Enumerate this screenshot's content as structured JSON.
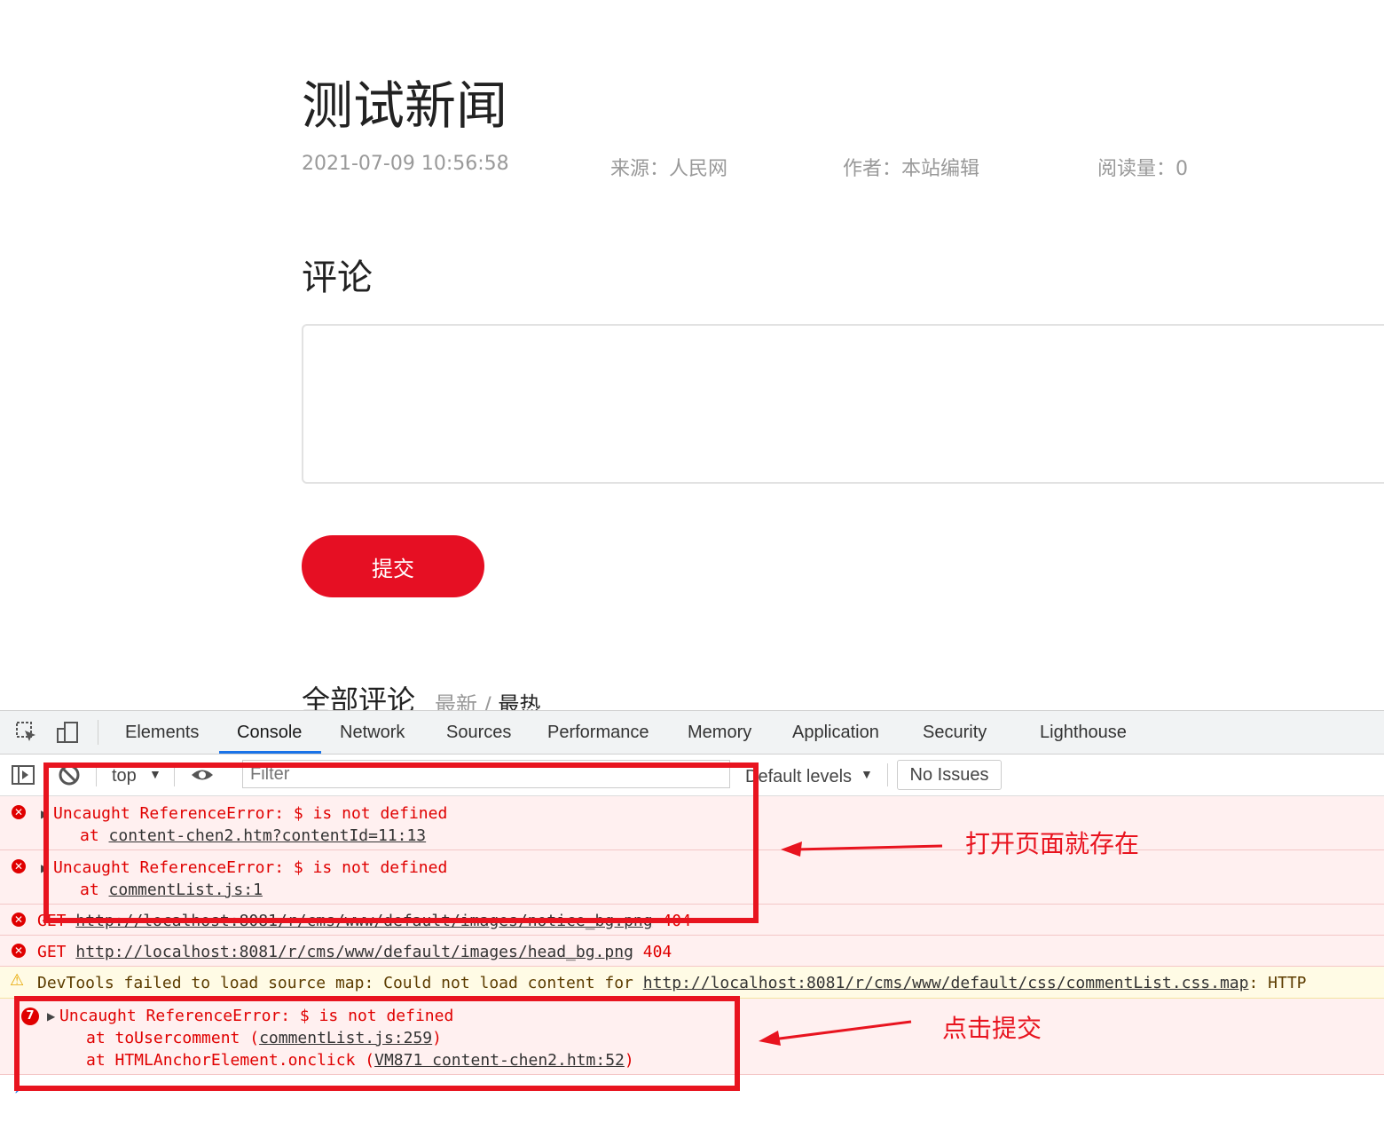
{
  "article": {
    "title": "测试新闻",
    "date": "2021-07-09 10:56:58",
    "source": "来源：人民网",
    "author": "作者：本站编辑",
    "reads": "阅读量：0"
  },
  "comment": {
    "heading": "评论",
    "submit_label": "提交",
    "all_label": "全部评论",
    "sort_latest": "最新",
    "sort_sep": " / ",
    "sort_hot": "最热"
  },
  "devtools": {
    "tabs": [
      "Elements",
      "Console",
      "Network",
      "Sources",
      "Performance",
      "Memory",
      "Application",
      "Security",
      "Lighthouse"
    ],
    "active_tab": "Console",
    "context": "top",
    "filter_placeholder": "Filter",
    "levels": "Default levels",
    "issues": "No Issues",
    "messages": [
      {
        "type": "error",
        "text": "Uncaught ReferenceError: $ is not defined",
        "at_prefix": "at ",
        "link": "content-chen2.htm?contentId=11:13"
      },
      {
        "type": "error",
        "text": "Uncaught ReferenceError: $ is not defined",
        "at_prefix": "at ",
        "link": "commentList.js:1"
      },
      {
        "type": "error",
        "method": "GET",
        "url": "http://localhost:8081/r/cms/www/default/images/notice_bg.png",
        "status": "404"
      },
      {
        "type": "error",
        "method": "GET",
        "url": "http://localhost:8081/r/cms/www/default/images/head_bg.png",
        "status": "404"
      },
      {
        "type": "warning",
        "text": "DevTools failed to load source map: Could not load content for ",
        "url": "http://localhost:8081/r/cms/www/default/css/commentList.css.map",
        "suffix": ": HTTP"
      },
      {
        "type": "error",
        "count": "7",
        "text": "Uncaught ReferenceError: $ is not defined",
        "stack1_prefix": "at toUsercomment (",
        "stack1_link": "commentList.js:259",
        "stack1_suffix": ")",
        "stack2_prefix": "at HTMLAnchorElement.onclick (",
        "stack2_link": "VM871 content-chen2.htm:52",
        "stack2_suffix": ")"
      }
    ]
  },
  "annotations": {
    "note1": "打开页面就存在",
    "note2": "点击提交",
    "color": "#e8141f"
  }
}
